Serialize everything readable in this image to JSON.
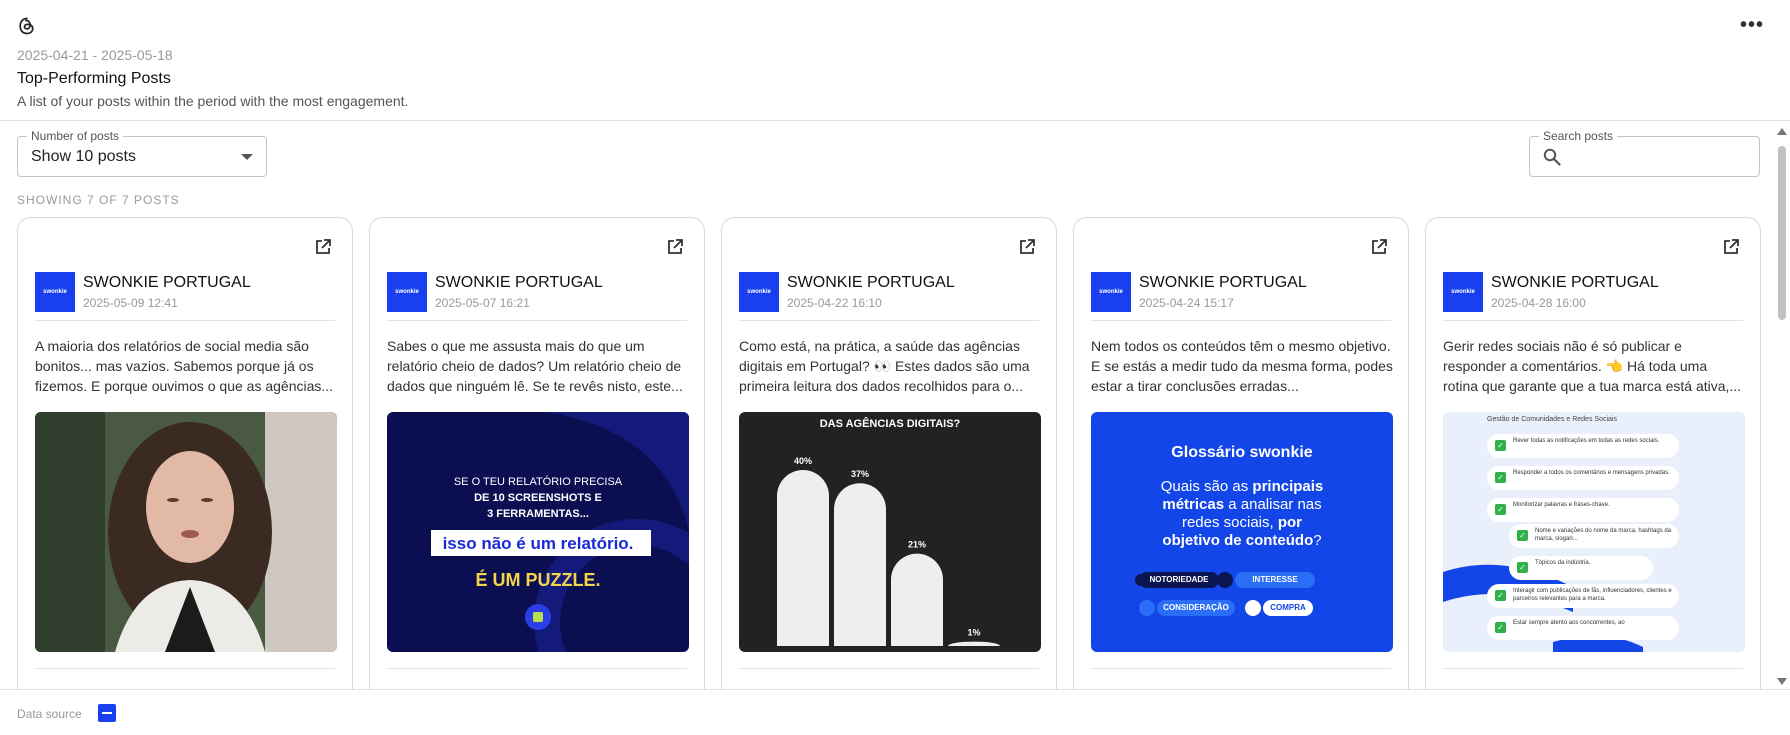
{
  "header": {
    "date_range": "2025-04-21 - 2025-05-18",
    "title": "Top-Performing Posts",
    "subtitle": "A list of your posts within the period with the most engagement.",
    "more_icon": "more-horizontal-icon"
  },
  "controls": {
    "number_label": "Number of posts",
    "number_value": "Show 10 posts",
    "search_label": "Search posts",
    "search_placeholder": "",
    "showing": "SHOWING 7 OF 7 POSTS"
  },
  "posts": [
    {
      "account": "SWONKIE PORTUGAL",
      "avatar_text": "swonkie",
      "timestamp": "2025-05-09 12:41",
      "text": "A maioria dos relatórios de social media são bonitos... mas vazios. Sabemos porque já os fizemos. E porque ouvimos o que as agências..."
    },
    {
      "account": "SWONKIE PORTUGAL",
      "avatar_text": "swonkie",
      "timestamp": "2025-05-07 16:21",
      "text": "Sabes o que me assusta mais do que um relatório cheio de dados? Um relatório cheio de dados que ninguém lê. Se te revês nisto, este...",
      "media": {
        "line1": "SE O TEU RELATÓRIO PRECISA",
        "line2": "DE 10 SCREENSHOTS E",
        "line3": "3 FERRAMENTAS...",
        "highlight": "isso não é um relatório.",
        "puzzle": "É UM PUZZLE."
      }
    },
    {
      "account": "SWONKIE PORTUGAL",
      "avatar_text": "swonkie",
      "timestamp": "2025-04-22 16:10",
      "text": "Como está, na prática, a saúde das agências digitais em Portugal? 👀 Estes dados são uma primeira leitura dos dados recolhidos para o...",
      "media": {
        "heading": "DAS AGÊNCIAS DIGITAIS?",
        "bars": [
          {
            "label": "40%",
            "value": 40
          },
          {
            "label": "37%",
            "value": 37
          },
          {
            "label": "21%",
            "value": 21
          },
          {
            "label": "1%",
            "value": 1
          }
        ]
      }
    },
    {
      "account": "SWONKIE PORTUGAL",
      "avatar_text": "swonkie",
      "timestamp": "2025-04-24 15:17",
      "text": "Nem todos os conteúdos têm o mesmo objetivo. E se estás a medir tudo da mesma forma, podes estar a tirar conclusões erradas...",
      "media": {
        "title": "Glossário swonkie",
        "q1": "Quais são as ",
        "q2": "principais",
        "q3": "métricas",
        "q4": " a analisar nas",
        "q5": "redes sociais, ",
        "q6": "por",
        "q7": "objetivo de conteúdo",
        "q8": "?",
        "tags": [
          "NOTORIEDADE",
          "INTERESSE",
          "CONSIDERAÇÃO",
          "COMPRA"
        ]
      }
    },
    {
      "account": "SWONKIE PORTUGAL",
      "avatar_text": "swonkie",
      "timestamp": "2025-04-28 16:00",
      "text": "Gerir redes sociais não é só publicar e responder a comentários. 👈 Há toda uma rotina que garante que a tua marca está ativa,...",
      "media": {
        "heading": "Gestão de Comunidades e Redes Sociais",
        "items": [
          "Rever todas as notificações em todas as redes sociais.",
          "Responder a todos os comentários e mensagens privadas.",
          "Monitorizar palavras e frases-chave.",
          "Nome e variações do nome da marca, hashtags da marca, slogan...",
          "Tópicos da indústria.",
          "Interagir com publicações de fãs, influenciadores, clientes e parceiros relevantes para a marca.",
          "Estar sempre atento aos concorrentes, ao"
        ]
      }
    }
  ],
  "footer": {
    "label": "Data source"
  },
  "colors": {
    "brand_blue": "#1a3ff0",
    "border": "#d7d7d7"
  }
}
